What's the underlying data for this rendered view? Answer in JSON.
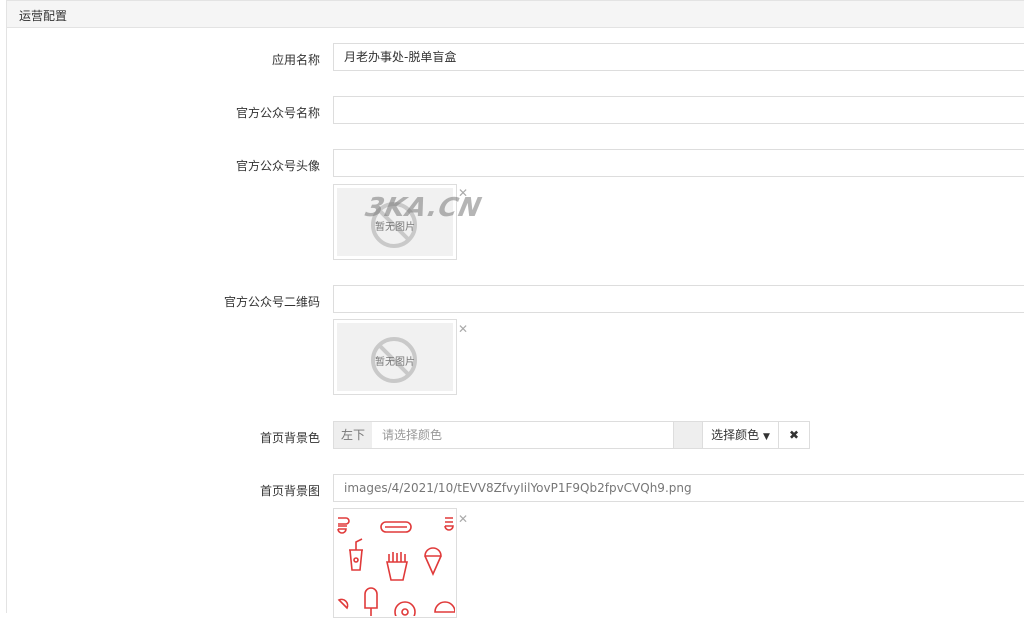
{
  "panel": {
    "title": "运营配置"
  },
  "fields": {
    "app_name": {
      "label": "应用名称",
      "value": "月老办事处-脱单盲盒"
    },
    "official_name": {
      "label": "官方公众号名称",
      "value": ""
    },
    "official_avatar": {
      "label": "官方公众号头像",
      "value": "",
      "thumb_text": "暂无图片"
    },
    "official_qrcode": {
      "label": "官方公众号二维码",
      "value": "",
      "thumb_text": "暂无图片"
    },
    "home_bg_color": {
      "label": "首页背景色",
      "prefix": "左下",
      "placeholder": "请选择颜色",
      "pick_label": "选择颜色",
      "swatch_color": "#eeeeee"
    },
    "home_bg_image": {
      "label": "首页背景图",
      "value": "images/4/2021/10/tEVV8ZfvyIilYovP1F9Qb2fpvCVQh9.png"
    }
  },
  "watermark": "3KA.CN",
  "icons": {
    "remove": "close-x-icon",
    "no_image": "no-image-icon",
    "caret": "caret-down-icon",
    "clear": "clear-x-icon"
  },
  "colors": {
    "food_icons": "#e03a3a",
    "border": "#dddddd",
    "header_bg": "#f5f5f5"
  }
}
